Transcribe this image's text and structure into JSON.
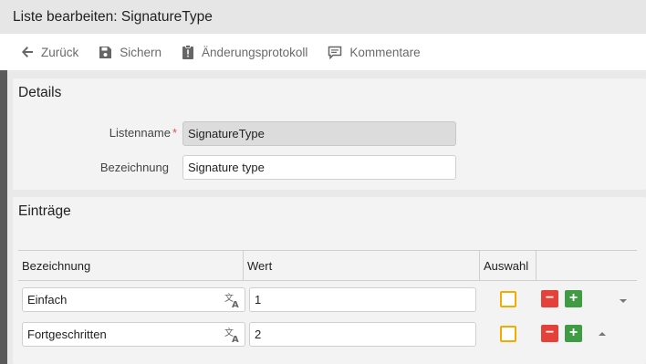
{
  "window": {
    "title": "Liste bearbeiten: SignatureType"
  },
  "toolbar": {
    "back_label": "Zurück",
    "save_label": "Sichern",
    "changelog_label": "Änderungsprotokoll",
    "comments_label": "Kommentare"
  },
  "details": {
    "title": "Details",
    "listname_label": "Listenname",
    "listname_required_mark": "*",
    "listname_value": "SignatureType",
    "bezeichnung_label": "Bezeichnung",
    "bezeichnung_value": "Signature type"
  },
  "entries": {
    "title": "Einträge",
    "columns": [
      "Bezeichnung",
      "Wert",
      "Auswahl"
    ],
    "rows": [
      {
        "bezeichnung": "Einfach",
        "wert": "1",
        "auswahl": false,
        "move": "down"
      },
      {
        "bezeichnung": "Fortgeschritten",
        "wert": "2",
        "auswahl": false,
        "move": "up"
      }
    ],
    "minus_symbol": "−",
    "plus_symbol": "+"
  },
  "colors": {
    "titlebar_bg": "#e6e6e6",
    "toolbar_bg": "#ffffff",
    "panel_bg": "#f3f3f3",
    "checkbox_border": "#f0ad00",
    "minus_button": "#e3413a",
    "plus_button": "#3f9c45"
  },
  "icons": {
    "back": "arrow-left-icon",
    "save": "floppy-disk-icon",
    "changelog": "clipboard-alert-icon",
    "comments": "comment-icon",
    "translate": "translate-icon"
  }
}
